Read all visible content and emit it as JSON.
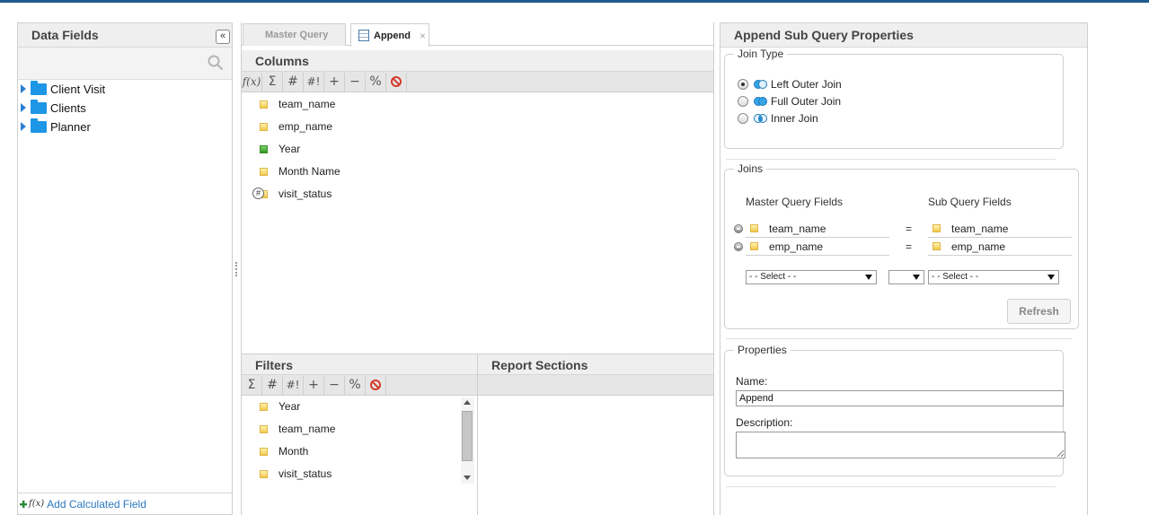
{
  "data_fields": {
    "title": "Data Fields",
    "collapse_glyph": "«",
    "search_placeholder": "",
    "tree": [
      {
        "label": "Client Visit"
      },
      {
        "label": "Clients"
      },
      {
        "label": "Planner"
      }
    ],
    "add_calculated_field": "Add Calculated Field",
    "add_calc_icon_text": "f(x)"
  },
  "tabs": [
    {
      "label": "Master Query"
    },
    {
      "label": "Append",
      "close": "×"
    }
  ],
  "columns": {
    "title": "Columns",
    "toolbar": [
      "f(x)",
      "Σ",
      "#",
      "#!",
      "+",
      "−",
      "%"
    ],
    "items": [
      {
        "label": "team_name",
        "icon": "dimension-icon"
      },
      {
        "label": "emp_name",
        "icon": "dimension-icon"
      },
      {
        "label": "Year",
        "icon": "date-field-icon"
      },
      {
        "label": "Month Name",
        "icon": "dimension-icon"
      },
      {
        "label": "visit_status",
        "icon": "calculated-dimension-icon",
        "badge": "#"
      }
    ]
  },
  "filters": {
    "title": "Filters",
    "toolbar": [
      "Σ",
      "#",
      "#!",
      "+",
      "−",
      "%"
    ],
    "items": [
      {
        "label": "Year"
      },
      {
        "label": "team_name"
      },
      {
        "label": "Month"
      },
      {
        "label": "visit_status"
      }
    ]
  },
  "report_sections": {
    "title": "Report Sections"
  },
  "properties_panel": {
    "title": "Append Sub Query Properties",
    "join_type": {
      "legend": "Join Type",
      "options": [
        {
          "label": "Left Outer Join",
          "checked": true
        },
        {
          "label": "Full Outer Join",
          "checked": false
        },
        {
          "label": "Inner Join",
          "checked": false
        }
      ]
    },
    "joins": {
      "legend": "Joins",
      "master_header": "Master Query Fields",
      "sub_header": "Sub Query Fields",
      "rows": [
        {
          "master": "team_name",
          "op": "=",
          "sub": "team_name"
        },
        {
          "master": "emp_name",
          "op": "=",
          "sub": "emp_name"
        }
      ],
      "master_select": "- - Select - -",
      "op_select": "",
      "sub_select": "- - Select - -",
      "refresh": "Refresh"
    },
    "properties": {
      "legend": "Properties",
      "name_label": "Name:",
      "name_value": "Append",
      "description_label": "Description:",
      "description_value": ""
    }
  },
  "colors": {
    "accent": "#1f5b8c",
    "folder": "#1e96e6",
    "link": "#2a78c2",
    "stop": "#d53a2a"
  }
}
